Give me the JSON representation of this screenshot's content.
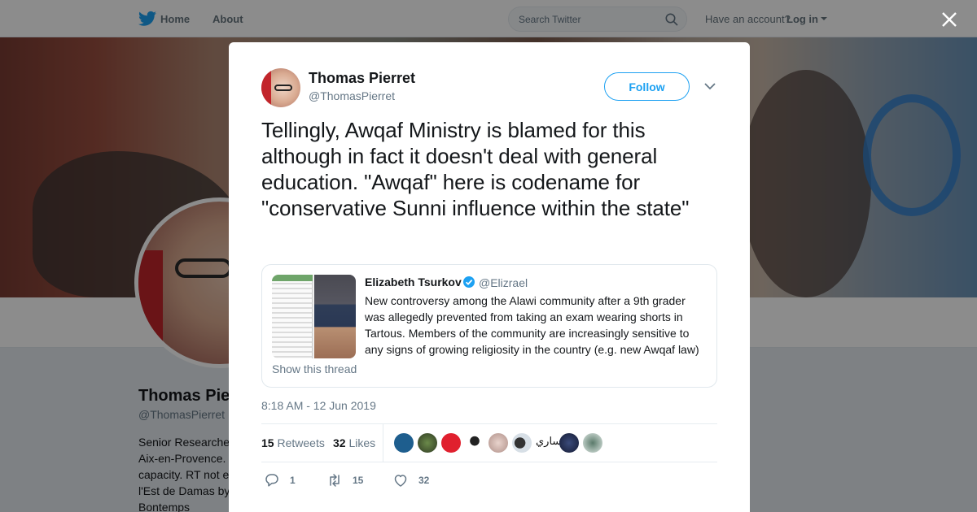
{
  "nav": {
    "home": "Home",
    "about": "About",
    "search_placeholder": "Search Twitter",
    "have_account": "Have an account?",
    "login": "Log in"
  },
  "profile": {
    "name": "Thomas Pierret",
    "handle": "@ThomasPierret",
    "bio_lines": [
      "Senior Researche",
      "Aix-en-Provence.",
      "capacity. RT not e",
      "l'Est de Damas by",
      "Bontemps"
    ]
  },
  "tweet": {
    "author_name": "Thomas Pierret",
    "author_handle": "@ThomasPierret",
    "follow_label": "Follow",
    "text": "Tellingly, Awqaf Ministry is blamed for this although in fact it doesn't deal with general education. \"Awqaf\" here is codename for \"conservative Sunni influence within the state\"",
    "timestamp": "8:18 AM - 12 Jun 2019",
    "retweets_count": "15",
    "retweets_label": "Retweets",
    "likes_count": "32",
    "likes_label": "Likes",
    "reply_count": "1",
    "retweet_action_count": "15",
    "like_action_count": "32",
    "liker_text": "ساري"
  },
  "quote": {
    "user": "Elizabeth Tsurkov",
    "handle": "@Elizrael",
    "text": "New controversy among the Alawi community after a 9th grader was allegedly prevented from taking an exam wearing shorts in Tartous. Members of the community are increasingly sensitive to any signs of growing religiosity in the country (e.g. new Awqaf law)",
    "show_thread": "Show this thread"
  },
  "colors": {
    "accent": "#1da1f2",
    "secondary_text": "#657786",
    "overlay": "rgba(0,0,0,0.45)"
  },
  "icons": [
    "twitter-bird-icon",
    "search-icon",
    "caret-down-icon",
    "close-icon",
    "chevron-down-icon",
    "verified-icon",
    "reply-icon",
    "retweet-icon",
    "like-icon"
  ]
}
